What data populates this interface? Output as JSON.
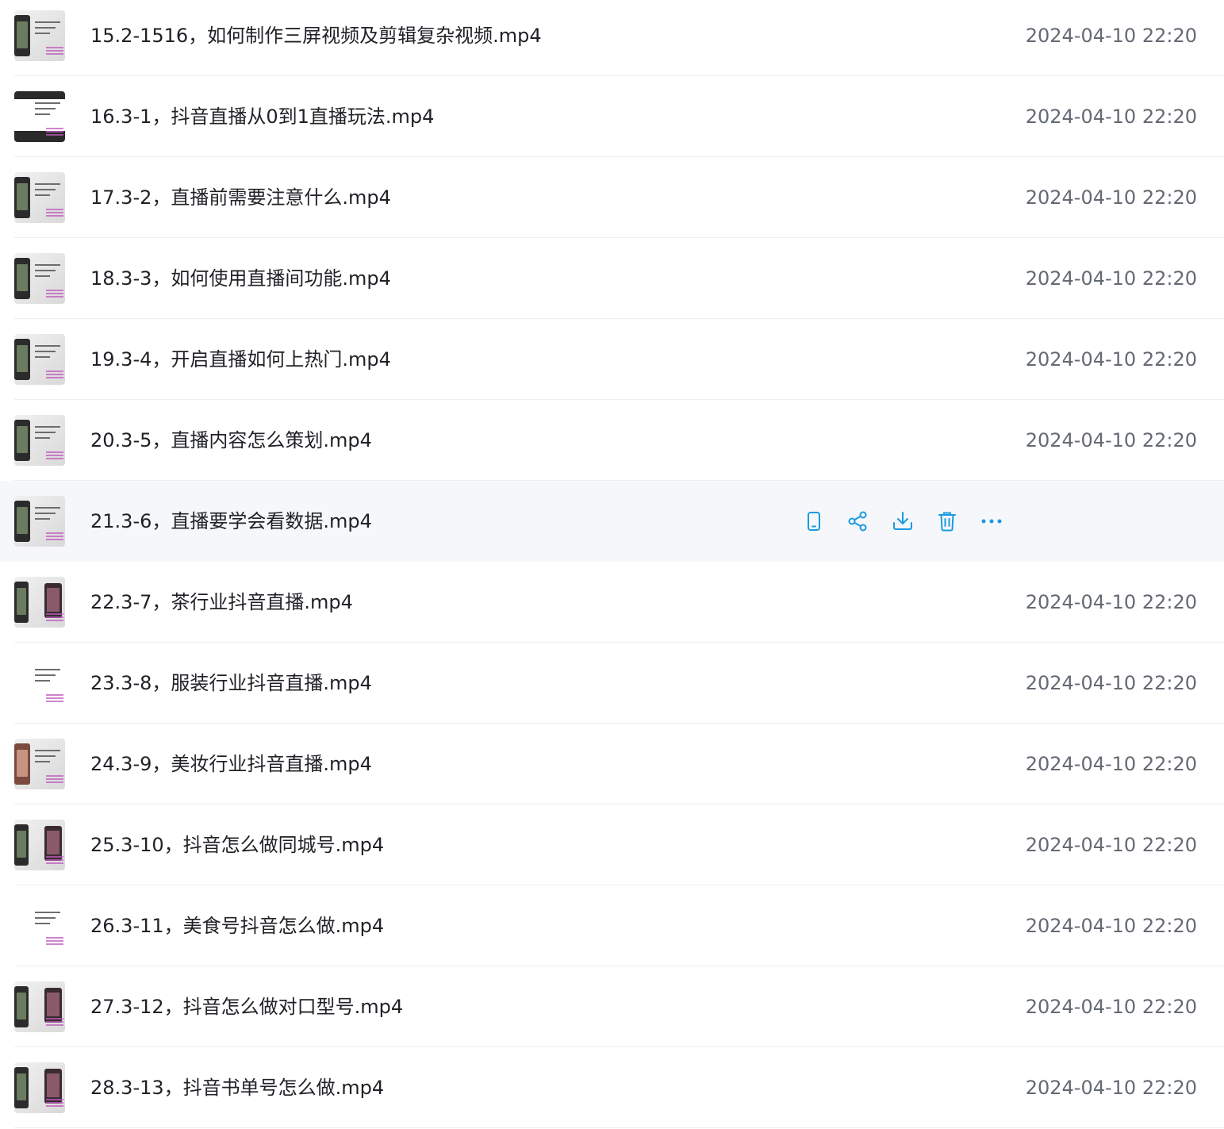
{
  "accent_color": "#1a9ae0",
  "files": [
    {
      "name": "15.2-1516，如何制作三屏视频及剪辑复杂视频.mp4",
      "time": "2024-04-10 22:20",
      "thumb": "phone"
    },
    {
      "name": "16.3-1，抖音直播从0到1直播玩法.mp4",
      "time": "2024-04-10 22:20",
      "thumb": "dark"
    },
    {
      "name": "17.3-2，直播前需要注意什么.mp4",
      "time": "2024-04-10 22:20",
      "thumb": "phone"
    },
    {
      "name": "18.3-3，如何使用直播间功能.mp4",
      "time": "2024-04-10 22:20",
      "thumb": "phone"
    },
    {
      "name": "19.3-4，开启直播如何上热门.mp4",
      "time": "2024-04-10 22:20",
      "thumb": "phone"
    },
    {
      "name": "20.3-5，直播内容怎么策划.mp4",
      "time": "2024-04-10 22:20",
      "thumb": "phone"
    },
    {
      "name": "21.3-6，直播要学会看数据.mp4",
      "time": "",
      "thumb": "phone",
      "hovered": true
    },
    {
      "name": "22.3-7，茶行业抖音直播.mp4",
      "time": "2024-04-10 22:20",
      "thumb": "two"
    },
    {
      "name": "23.3-8，服装行业抖音直播.mp4",
      "time": "2024-04-10 22:20",
      "thumb": "white"
    },
    {
      "name": "24.3-9，美妆行业抖音直播.mp4",
      "time": "2024-04-10 22:20",
      "thumb": "face"
    },
    {
      "name": "25.3-10，抖音怎么做同城号.mp4",
      "time": "2024-04-10 22:20",
      "thumb": "two"
    },
    {
      "name": "26.3-11，美食号抖音怎么做.mp4",
      "time": "2024-04-10 22:20",
      "thumb": "white"
    },
    {
      "name": "27.3-12，抖音怎么做对口型号.mp4",
      "time": "2024-04-10 22:20",
      "thumb": "two"
    },
    {
      "name": "28.3-13，抖音书单号怎么做.mp4",
      "time": "2024-04-10 22:20",
      "thumb": "two"
    }
  ],
  "hover_actions": [
    {
      "icon": "mobile-icon"
    },
    {
      "icon": "share-icon"
    },
    {
      "icon": "download-icon"
    },
    {
      "icon": "trash-icon"
    },
    {
      "icon": "more-icon"
    }
  ]
}
